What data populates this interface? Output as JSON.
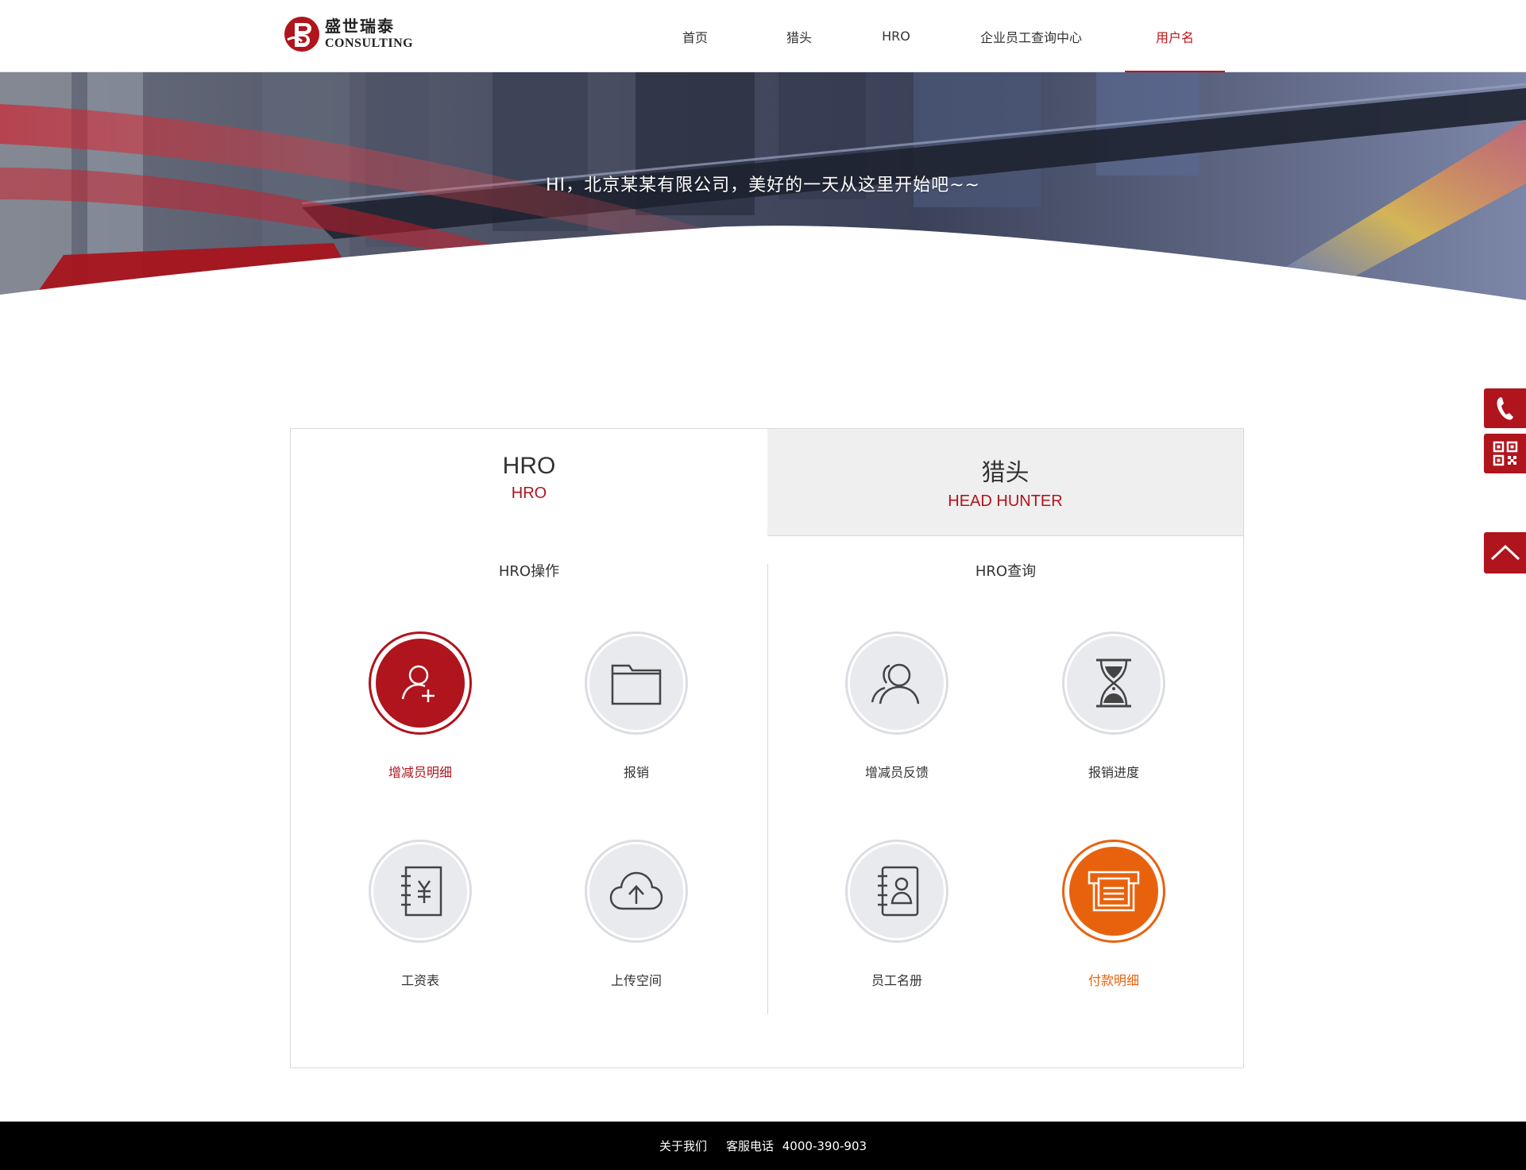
{
  "header": {
    "logo_cn": "盛世瑞泰",
    "logo_en": "CONSULTING",
    "nav": [
      {
        "label": "首页"
      },
      {
        "label": "猎头"
      },
      {
        "label": "HRO"
      },
      {
        "label": "企业员工查询中心"
      },
      {
        "label": "用户名"
      }
    ]
  },
  "banner": {
    "greeting": "HI，北京某某有限公司，美好的一天从这里开始吧~~"
  },
  "tabs": [
    {
      "title": "HRO",
      "subtitle": "HRO"
    },
    {
      "title": "猎头",
      "subtitle": "HEAD HUNTER"
    }
  ],
  "sections": [
    {
      "title": "HRO操作",
      "items": [
        {
          "label": "增减员明细",
          "icon": "add-user-icon",
          "state": "active-red"
        },
        {
          "label": "报销",
          "icon": "folder-icon"
        },
        {
          "label": "工资表",
          "icon": "salary-book-icon"
        },
        {
          "label": "上传空间",
          "icon": "cloud-upload-icon"
        }
      ]
    },
    {
      "title": "HRO查询",
      "items": [
        {
          "label": "增减员反馈",
          "icon": "users-icon"
        },
        {
          "label": "报销进度",
          "icon": "hourglass-icon"
        },
        {
          "label": "员工名册",
          "icon": "contacts-book-icon"
        },
        {
          "label": "付款明细",
          "icon": "printer-icon",
          "state": "active-orange"
        }
      ]
    }
  ],
  "float_bar": {
    "icons": [
      "phone-icon",
      "qr-code-icon",
      "back-to-top-icon"
    ]
  },
  "footer": {
    "about": "关于我们",
    "phone_label": "客服电话",
    "phone": "4000-390-903"
  },
  "colors": {
    "brand_red": "#b0141c",
    "accent_orange": "#e8620e"
  }
}
